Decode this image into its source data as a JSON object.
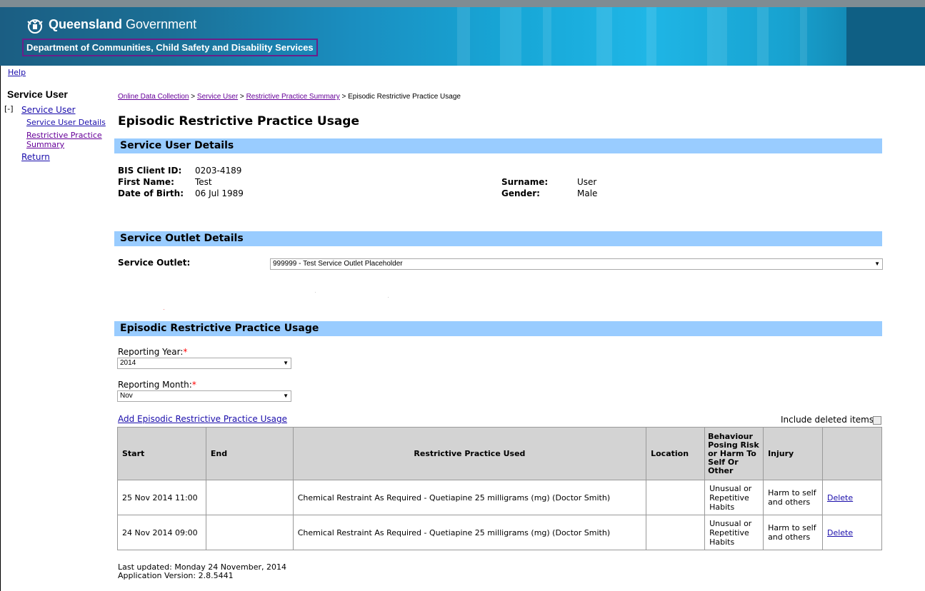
{
  "header": {
    "gov_bold": "Queensland",
    "gov_rest": " Government",
    "department": "Department of Communities, Child Safety and Disability Services"
  },
  "nav": {
    "help": "Help",
    "side_title": "Service User",
    "toggle": "[-]",
    "service_user": "Service User",
    "service_user_details": "Service User Details",
    "restrictive_practice_summary": "Restrictive Practice Summary",
    "return": "Return"
  },
  "breadcrumb": {
    "item1": "Online Data Collection",
    "sep": " > ",
    "item2": "Service User",
    "item3": "Restrictive Practice Summary",
    "current": "Episodic Restrictive Practice Usage"
  },
  "page_title": "Episodic Restrictive Practice Usage",
  "sections": {
    "user_details": "Service User Details",
    "outlet_details": "Service Outlet Details",
    "usage": "Episodic Restrictive Practice Usage"
  },
  "user": {
    "bis_label": "BIS Client ID:",
    "bis_value": "0203-4189",
    "first_label": "First Name:",
    "first_value": "Test",
    "dob_label": "Date of Birth:",
    "dob_value": "06 Jul 1989",
    "surname_label": "Surname:",
    "surname_value": "User",
    "gender_label": "Gender:",
    "gender_value": "Male"
  },
  "outlet": {
    "label": "Service Outlet:",
    "value": "999999 - Test Service Outlet Placeholder"
  },
  "filters": {
    "year_label": "Reporting Year:",
    "year_value": "2014",
    "month_label": "Reporting Month:",
    "month_value": "Nov",
    "required_mark": "*"
  },
  "actions": {
    "add": "Add Episodic Restrictive Practice Usage",
    "include_deleted": "Include deleted items"
  },
  "table": {
    "headers": [
      "Start",
      "End",
      "Restrictive Practice Used",
      "Location",
      "Behaviour Posing Risk or Harm To Self Or Other",
      "Injury",
      ""
    ],
    "rows": [
      {
        "start": "25 Nov 2014 11:00",
        "end": "",
        "practice": "Chemical Restraint As Required - Quetiapine 25 milligrams (mg) (Doctor Smith)",
        "location": "",
        "behaviour": "Unusual or Repetitive Habits",
        "injury": "Harm to self and others",
        "action": "Delete"
      },
      {
        "start": "24 Nov 2014 09:00",
        "end": "",
        "practice": "Chemical Restraint As Required - Quetiapine 25 milligrams (mg) (Doctor Smith)",
        "location": "",
        "behaviour": "Unusual or Repetitive Habits",
        "injury": "Harm to self and others",
        "action": "Delete"
      }
    ]
  },
  "footer": {
    "last_updated": "Last updated: Monday 24 November, 2014",
    "version": "Application Version: 2.8.5441"
  },
  "colors": {
    "section_bar": "#99ccff",
    "link": "#1a0dab",
    "visited_link": "#660099",
    "table_header": "#d3d3d3"
  }
}
